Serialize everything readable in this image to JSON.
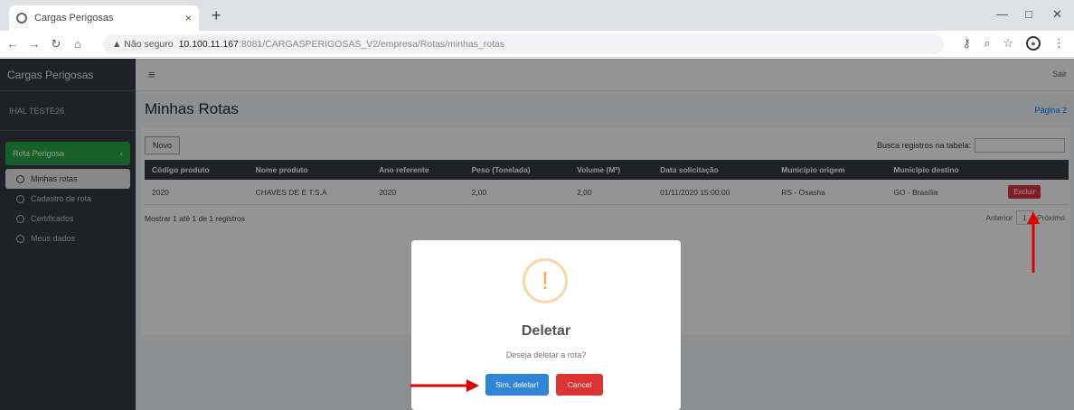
{
  "browser": {
    "tab_title": "Cargas Perigosas",
    "tab_close": "×",
    "new_tab": "+",
    "url_warning": "▲ Não seguro",
    "url_host": "10.100.11.167",
    "url_path": ":8081/CARGASPERIGOSAS_V2/empresa/Rotas/minhas_rotas",
    "window_controls": [
      "—",
      "□",
      "✕"
    ]
  },
  "sidebar": {
    "brand": "Cargas Perigosas",
    "user": "IHAL TESTE26",
    "menu_open": "Rota Perigosa",
    "items": [
      {
        "label": "Minhas rotas",
        "active": true
      },
      {
        "label": "Cadastro de rota",
        "active": false
      },
      {
        "label": "Certificados",
        "active": false
      },
      {
        "label": "Meus dados",
        "active": false
      }
    ]
  },
  "topnav": {
    "hamburger": "≡",
    "right_text": "Sair"
  },
  "content": {
    "title": "Minhas Rotas",
    "breadcrumb": "Página 2",
    "new_button": "Novo",
    "search_label": "Busca registros na tabela:",
    "search_placeholder": "",
    "table": {
      "headers": [
        "Código produto",
        "Nome produto",
        "Ano referente",
        "Peso (Tonelada)",
        "Volume (M³)",
        "Data solicitação",
        "Município origem",
        "Município destino",
        ""
      ],
      "rows": [
        [
          "2020",
          "CHAVES DE E T.S.A",
          "2020",
          "2,00",
          "2,00",
          "01/11/2020 15:00:00",
          "RS - Osasha",
          "GO - Brasília",
          "Excluir"
        ]
      ]
    },
    "info": "Mostrar 1 até 1 de 1 registros",
    "pager": {
      "prev": "Anterior",
      "current": "1",
      "next": "Próximo"
    }
  },
  "modal": {
    "icon": "!",
    "title": "Deletar",
    "text": "Deseja deletar a rota?",
    "confirm": "Sim, deletar!",
    "cancel": "Cancel"
  },
  "colors": {
    "sidebar": "#343a40",
    "menu_active": "#28a745",
    "danger": "#dc3545",
    "confirm": "#3085d6",
    "cancel": "#dd3333",
    "annotation": "#e00000"
  }
}
